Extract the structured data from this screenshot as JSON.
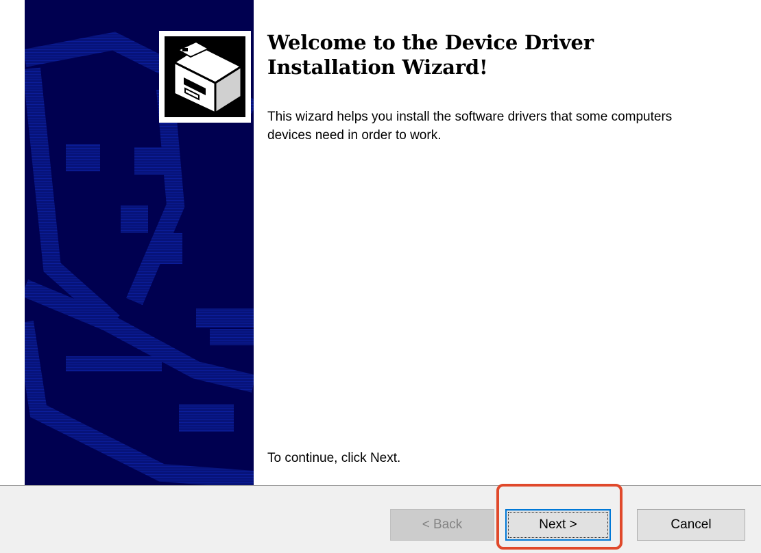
{
  "wizard": {
    "title": "Welcome to the Device Driver Installation Wizard!",
    "intro": "This wizard helps you install the software drivers that some computers devices need in order to work.",
    "continue_text": "To continue, click Next."
  },
  "banner": {
    "icon": "device-driver-icon",
    "background_color": "#000050",
    "art_color": "#0a1a8c"
  },
  "buttons": {
    "back_label": "< Back",
    "back_enabled": false,
    "next_label": "Next >",
    "cancel_label": "Cancel"
  },
  "annotation": {
    "highlight_target": "next-button",
    "color": "#e0492b"
  }
}
